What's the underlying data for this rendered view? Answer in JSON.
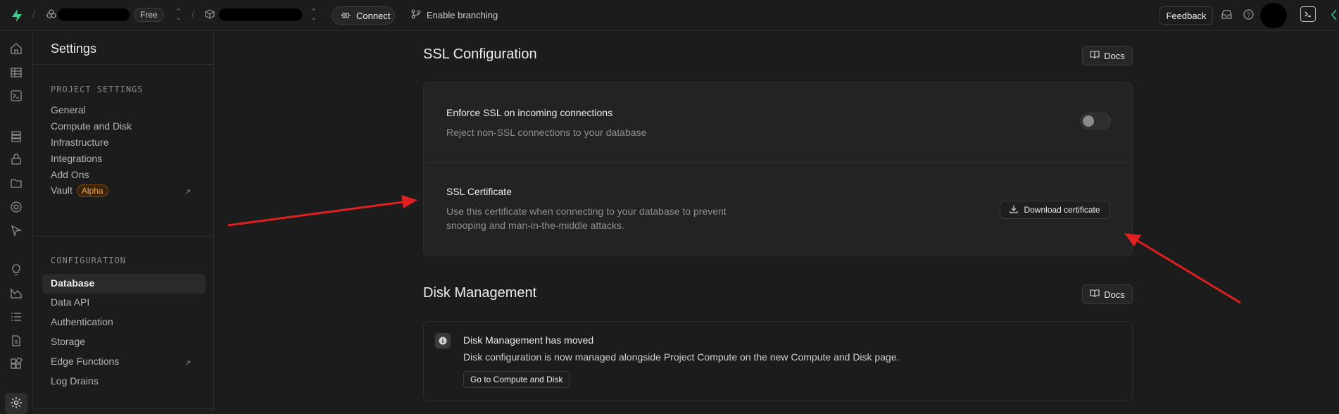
{
  "topbar": {
    "plan_badge": "Free",
    "connect_label": "Connect",
    "branching_label": "Enable branching",
    "feedback_label": "Feedback"
  },
  "settings_panel": {
    "title": "Settings",
    "project_section_label": "PROJECT SETTINGS",
    "project_items": [
      "General",
      "Compute and Disk",
      "Infrastructure",
      "Integrations",
      "Add Ons",
      "Vault"
    ],
    "vault_badge": "Alpha",
    "configuration_section_label": "CONFIGURATION",
    "configuration_items": [
      "Database",
      "Data API",
      "Authentication",
      "Storage",
      "Edge Functions",
      "Log Drains"
    ]
  },
  "ssl": {
    "heading": "SSL Configuration",
    "docs_label": "Docs",
    "enforce_title": "Enforce SSL on incoming connections",
    "enforce_desc": "Reject non-SSL connections to your database",
    "enforce_enabled": false,
    "cert_title": "SSL Certificate",
    "cert_desc_line1": "Use this certificate when connecting to your database to prevent",
    "cert_desc_line2": "snooping and man-in-the-middle attacks.",
    "download_label": "Download certificate"
  },
  "disk": {
    "heading": "Disk Management",
    "docs_label": "Docs",
    "notice_title": "Disk Management has moved",
    "notice_desc": "Disk configuration is now managed alongside Project Compute on the new Compute and Disk page.",
    "goto_label": "Go to Compute and Disk"
  },
  "colors": {
    "brand": "#3ecf8e",
    "annotation_arrow": "#e02020",
    "alpha_badge": "#f0a23a"
  }
}
